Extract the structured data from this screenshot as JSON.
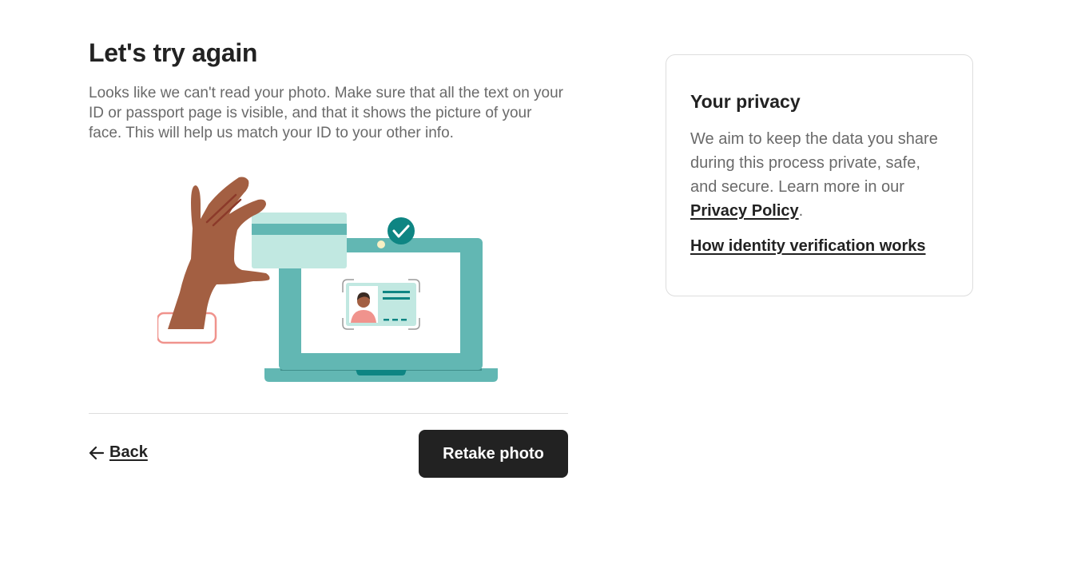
{
  "main": {
    "title": "Let's try again",
    "description": "Looks like we can't read your photo. Make sure that all the text on your ID or passport page is visible, and that it shows the picture of your face. This will help us match your ID to your other info.",
    "back_label": "Back",
    "retake_label": "Retake photo"
  },
  "privacy": {
    "title": "Your privacy",
    "text": "We aim to keep the data you share during this process private, safe, and secure. Learn more in our ",
    "policy_link": "Privacy Policy",
    "period": ".",
    "how_link": "How identity verification works"
  },
  "icons": {
    "back": "arrow-left-icon",
    "check": "check-circle-icon"
  },
  "colors": {
    "primary_text": "#222222",
    "secondary_text": "#6a6a6a",
    "button_bg": "#222222",
    "teal": "#62b7b3",
    "teal_dark": "#0e8583",
    "mint": "#c1e8e1",
    "skin": "#a35f42",
    "coral": "#f0938d"
  }
}
